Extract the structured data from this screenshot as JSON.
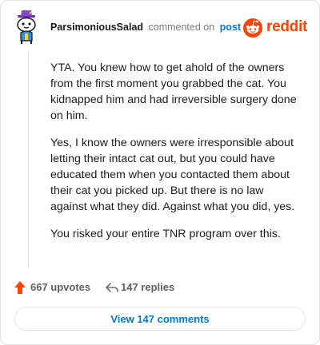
{
  "header": {
    "author": "ParsimoniousSalad",
    "action": "commented on",
    "post_link": "post",
    "brand": "reddit"
  },
  "comment": {
    "paragraphs": [
      "YTA. You knew how to get ahold of the owners from the first moment you grabbed the cat. You kidnapped him and had irreversible surgery done on him.",
      "Yes, I know the owners were irresponsible about letting their intact cat out, but you could have educated them when you contacted them about their cat you picked up. But there is no law against what they did. Against what you did, yes.",
      "You risked your entire TNR program over this."
    ]
  },
  "footer": {
    "upvotes": "667 upvotes",
    "replies": "147 replies",
    "view_button": "View 147 comments"
  },
  "icons": {
    "upvote": "upvote-arrow-icon",
    "reply": "reply-arrow-icon",
    "brand": "reddit-snoo-icon",
    "avatar": "user-avatar-snoo"
  },
  "colors": {
    "brand": "#ff4500",
    "link": "#0079d3",
    "upvote": "#ff4500",
    "avatar_hat": "#8a49c6"
  }
}
